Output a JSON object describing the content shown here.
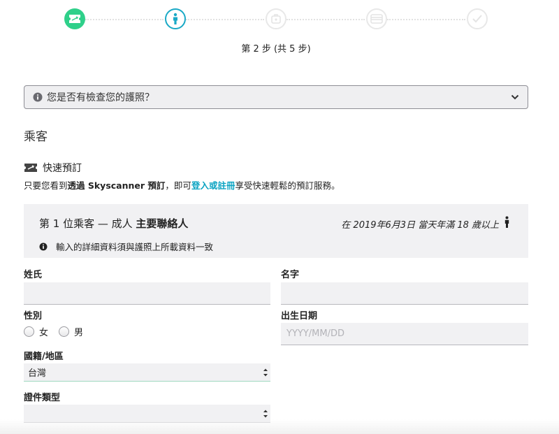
{
  "stepper": {
    "steps": [
      {
        "icon": "flight-ticket-icon",
        "state": "done",
        "color": "#2fd08a"
      },
      {
        "icon": "person-icon",
        "state": "active",
        "color": "#1aa9c6"
      },
      {
        "icon": "luggage-icon",
        "state": "todo"
      },
      {
        "icon": "credit-card-icon",
        "state": "todo"
      },
      {
        "icon": "checkmark-icon",
        "state": "todo"
      }
    ],
    "label": "第 2 步 (共 5 步)"
  },
  "passport": {
    "question": "您是否有檢查您的護照？"
  },
  "section_title": "乘客",
  "fast_booking": {
    "label": "快速預訂",
    "desc_pre": "只要您看到",
    "desc_bold": "透過 Skyscanner 預訂",
    "desc_mid": "，即可",
    "desc_link": "登入或註冊",
    "desc_post": "享受快速輕鬆的預訂服務。"
  },
  "passenger": {
    "title_prefix": "第 1 位乘客 — 成人 ",
    "title_bold": "主要聯絡人",
    "age_note": "在 2019年6月3日 當天年滿 18 歲以上",
    "info_note": "輸入的詳細資料須與護照上所載資料一致"
  },
  "form": {
    "surname_label": "姓氏",
    "surname_value": "",
    "given_name_label": "名字",
    "given_name_value": "",
    "gender_label": "性別",
    "gender_options": [
      "女",
      "男"
    ],
    "dob_label": "出生日期",
    "dob_placeholder": "YYYY/MM/DD",
    "nationality_label": "國籍/地區",
    "nationality_value": "台灣",
    "document_type_label": "證件類型",
    "document_type_value": ""
  }
}
